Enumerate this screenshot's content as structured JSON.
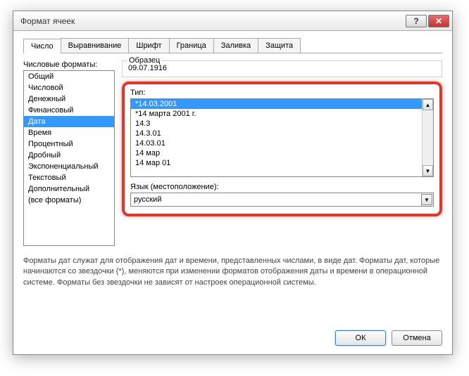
{
  "window": {
    "title": "Формат ячеек"
  },
  "tabs": [
    "Число",
    "Выравнивание",
    "Шрифт",
    "Граница",
    "Заливка",
    "Защита"
  ],
  "left": {
    "label": "Числовые форматы:",
    "items": [
      "Общий",
      "Числовой",
      "Денежный",
      "Финансовый",
      "Дата",
      "Время",
      "Процентный",
      "Дробный",
      "Экспоненциальный",
      "Текстовый",
      "Дополнительный",
      "(все форматы)"
    ],
    "selected": 4
  },
  "sample": {
    "label": "Образец",
    "value": "09.07.1916"
  },
  "type": {
    "label": "Тип:",
    "items": [
      "*14.03.2001",
      "*14 марта 2001 г.",
      "14.3",
      "14.3.01",
      "14.03.01",
      "14 мар",
      "14 мар 01"
    ],
    "selected": 0
  },
  "locale": {
    "label": "Язык (местоположение):",
    "value": "русский"
  },
  "desc": "Форматы дат служат для отображения дат и времени, представленных числами, в виде дат. Форматы дат, которые начинаются со звездочки (*), меняются при изменении форматов отображения даты и времени в операционной системе. Форматы без звездочки не зависят от настроек операционной системы.",
  "buttons": {
    "ok": "ОК",
    "cancel": "Отмена"
  }
}
